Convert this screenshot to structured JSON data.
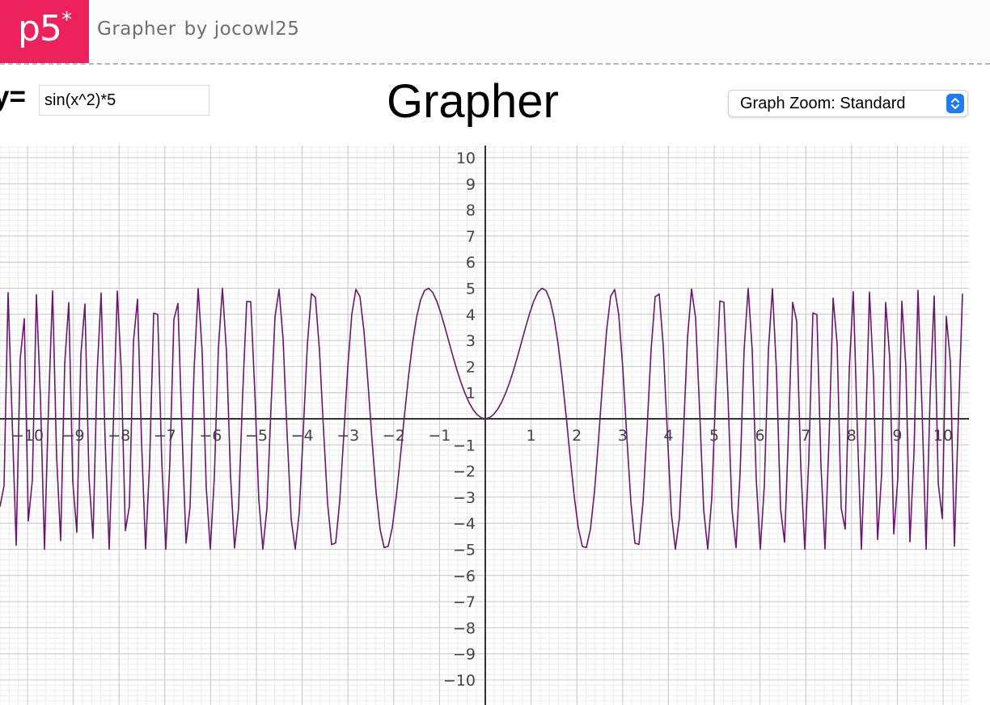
{
  "app": {
    "logo_text": "p5",
    "logo_star": "*",
    "sketch_name": "Grapher",
    "by_label": "by",
    "author": "jocowl25"
  },
  "controls": {
    "y_label": "y=",
    "equation": "sin(x^2)*5",
    "heading": "Grapher",
    "zoom_label": "Graph Zoom: Standard"
  },
  "colors": {
    "brand": "#ed225d",
    "curve": "#6b176f",
    "select_accent": "#1f7bf2"
  },
  "chart_data": {
    "type": "line",
    "function": "sin(x^2)*5",
    "xlim": [
      -10.6,
      10.5
    ],
    "ylim": [
      -10.5,
      10.5
    ],
    "x_ticks": [
      -10,
      -9,
      -8,
      -7,
      -6,
      -5,
      -4,
      -3,
      -2,
      -1,
      1,
      2,
      3,
      4,
      5,
      6,
      7,
      8,
      9,
      10
    ],
    "y_ticks": [
      10,
      9,
      8,
      7,
      6,
      5,
      4,
      3,
      2,
      1,
      -1,
      -2,
      -3,
      -4,
      -5,
      -6,
      -7,
      -8,
      -9,
      -10
    ],
    "grid": true
  }
}
